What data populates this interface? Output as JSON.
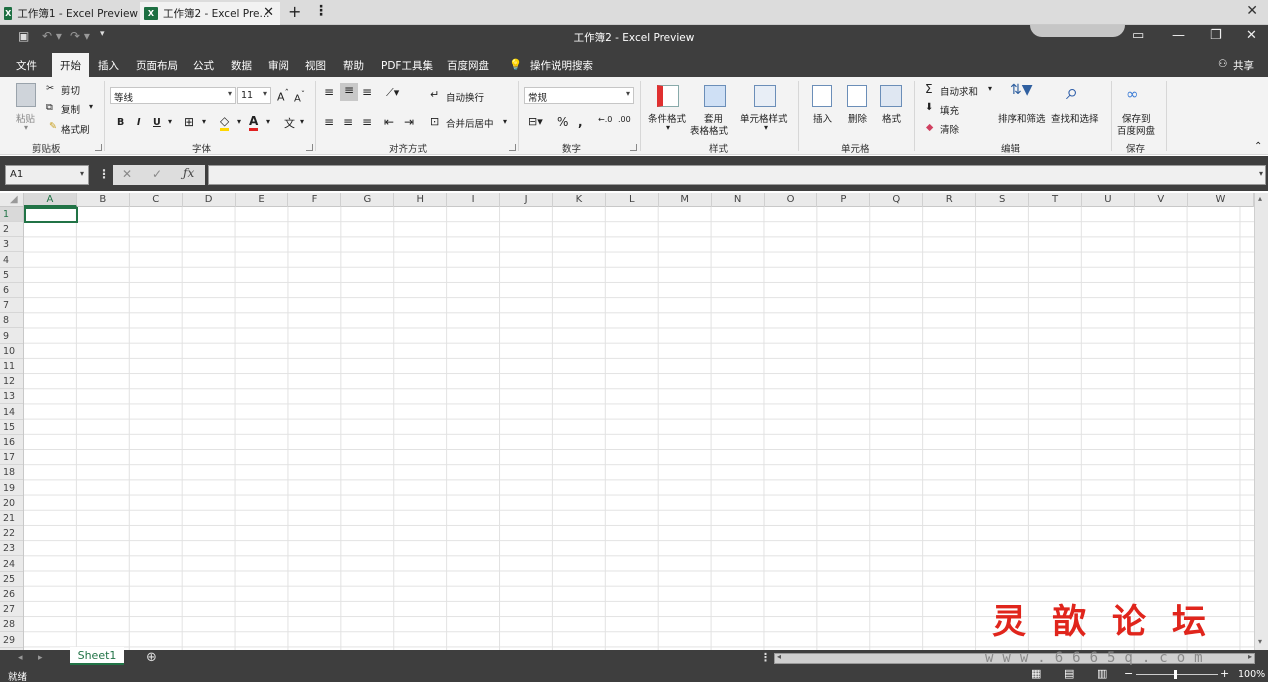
{
  "tabs": [
    {
      "label": "工作簿1 - Excel Preview"
    },
    {
      "label": "工作簿2 - Excel Pre..."
    }
  ],
  "icons": {
    "new_tab": "+",
    "close": "✕",
    "tab_menu": "⋮"
  },
  "title": "工作簿2 - Excel Preview",
  "menu": [
    "文件",
    "开始",
    "插入",
    "页面布局",
    "公式",
    "数据",
    "审阅",
    "视图",
    "帮助",
    "PDF工具集",
    "百度网盘"
  ],
  "tell_me": "操作说明搜索",
  "share": "共享",
  "ribbon": {
    "clipboard": {
      "paste": "粘贴",
      "cut": "剪切",
      "copy": "复制",
      "format_painter": "格式刷",
      "group": "剪贴板"
    },
    "font": {
      "name": "等线",
      "size": "11",
      "group": "字体"
    },
    "alignment": {
      "wrap": "自动换行",
      "merge": "合并后居中",
      "group": "对齐方式"
    },
    "number": {
      "format": "常规",
      "group": "数字"
    },
    "styles": {
      "conditional": "条件格式",
      "table_l1": "套用",
      "table_l2": "表格格式",
      "cell_styles": "单元格样式",
      "group": "样式"
    },
    "cells": {
      "insert": "插入",
      "delete": "删除",
      "format": "格式",
      "group": "单元格"
    },
    "editing": {
      "autosum": "自动求和",
      "fill": "填充",
      "clear": "清除",
      "sort": "排序和筛选",
      "find": "查找和选择",
      "group": "编辑"
    },
    "save": {
      "l1": "保存到",
      "l2": "百度网盘",
      "group": "保存"
    }
  },
  "namebox": "A1",
  "columns": [
    "A",
    "B",
    "C",
    "D",
    "E",
    "F",
    "G",
    "H",
    "I",
    "J",
    "K",
    "L",
    "M",
    "N",
    "O",
    "P",
    "Q",
    "R",
    "S",
    "T",
    "U",
    "V",
    "W"
  ],
  "rows": [
    "1",
    "2",
    "3",
    "4",
    "5",
    "6",
    "7",
    "8",
    "9",
    "10",
    "11",
    "12",
    "13",
    "14",
    "15",
    "16",
    "17",
    "18",
    "19",
    "20",
    "21",
    "22",
    "23",
    "24",
    "25",
    "26",
    "27",
    "28",
    "29"
  ],
  "sheet": "Sheet1",
  "status": {
    "ready": "就绪",
    "zoom": "100%"
  },
  "watermark": {
    "chars": "灵歆论坛",
    "url": "www.6665q.com"
  }
}
